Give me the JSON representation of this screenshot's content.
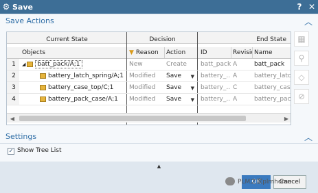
{
  "window": {
    "title": "Save"
  },
  "save_actions": {
    "heading": "Save Actions",
    "groups": {
      "current_state": "Current State",
      "decision": "Decision",
      "end_state": "End State"
    },
    "columns": {
      "objects": "Objects",
      "reason": "Reason",
      "action": "Action",
      "id": "ID",
      "revision": "Revisio",
      "name": "Name"
    },
    "rows": [
      {
        "index": "1",
        "object": "batt_pack/A;1",
        "reason": "New",
        "action": "Create",
        "id": "batt_pack",
        "revision": "A",
        "name": "batt_pack",
        "has_dropdown": false
      },
      {
        "index": "2",
        "object": "battery_latch_spring/A;1",
        "reason": "Modified",
        "action": "Save",
        "id": "battery_...",
        "revision": "A",
        "name": "battery_latch...",
        "has_dropdown": true
      },
      {
        "index": "3",
        "object": "battery_case_top/C;1",
        "reason": "Modified",
        "action": "Save",
        "id": "battery_...",
        "revision": "C",
        "name": "battery_cas...",
        "has_dropdown": true
      },
      {
        "index": "4",
        "object": "battery_pack_case/A;1",
        "reason": "Modified",
        "action": "Save",
        "id": "battery_...",
        "revision": "A",
        "name": "battery_pack...",
        "has_dropdown": true
      }
    ]
  },
  "settings": {
    "heading": "Settings",
    "show_tree_list_label": "Show Tree List",
    "show_tree_list_checked": true
  },
  "buttons": {
    "ok": "OK",
    "cancel": "Cancel"
  },
  "watermark": {
    "text": "PLM之家plmhome"
  },
  "colors": {
    "titlebar": "#3d6e96",
    "accent": "#2f6ea6",
    "ok_button": "#3a7abf"
  }
}
